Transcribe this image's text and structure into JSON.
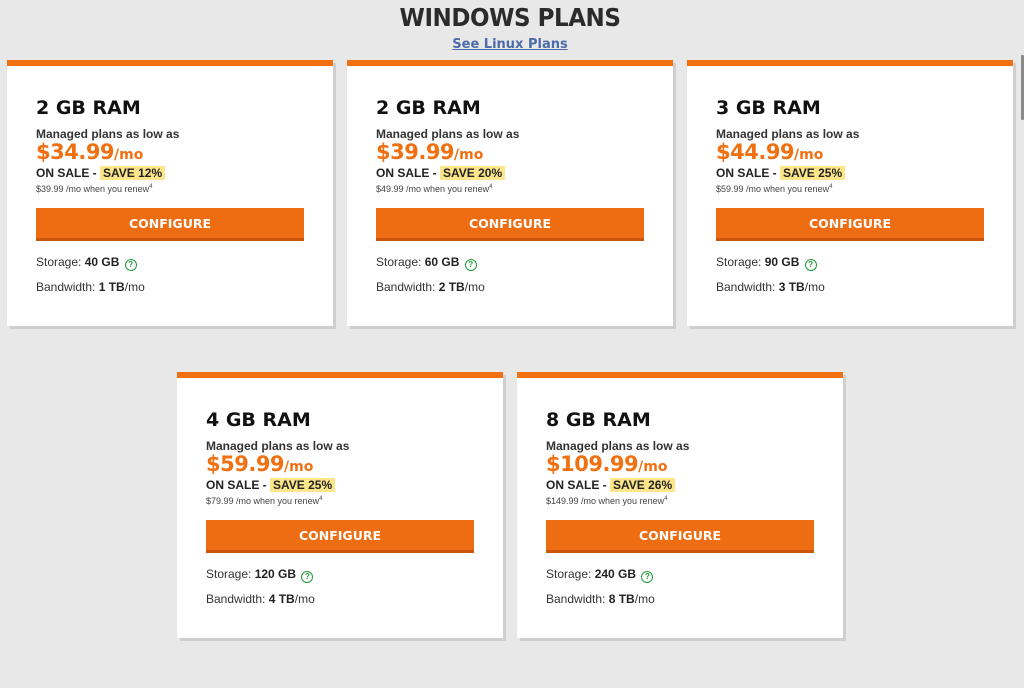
{
  "header": {
    "title": "WINDOWS PLANS",
    "link_label": "See Linux Plans"
  },
  "colors": {
    "accent": "#f07012",
    "save_highlight": "#fde68a",
    "help_icon": "#1f9d3a",
    "link": "#4b6ca8"
  },
  "plans": [
    {
      "ram": "2 GB RAM",
      "managed": "Managed plans as low as",
      "price": "$34.99",
      "per": "/mo",
      "on_sale": "ON SALE - ",
      "save": "SAVE 12%",
      "renew": "$39.99 /mo when you renew",
      "footnote": "4",
      "button": "CONFIGURE",
      "storage_label": "Storage: ",
      "storage": "40 GB",
      "bandwidth_label": "Bandwidth: ",
      "bandwidth": "1 TB",
      "bandwidth_unit": "/mo"
    },
    {
      "ram": "2 GB RAM",
      "managed": "Managed plans as low as",
      "price": "$39.99",
      "per": "/mo",
      "on_sale": "ON SALE - ",
      "save": "SAVE 20%",
      "renew": "$49.99 /mo when you renew",
      "footnote": "4",
      "button": "CONFIGURE",
      "storage_label": "Storage: ",
      "storage": "60 GB",
      "bandwidth_label": "Bandwidth: ",
      "bandwidth": "2 TB",
      "bandwidth_unit": "/mo"
    },
    {
      "ram": "3 GB RAM",
      "managed": "Managed plans as low as",
      "price": "$44.99",
      "per": "/mo",
      "on_sale": "ON SALE - ",
      "save": "SAVE 25%",
      "renew": "$59.99 /mo when you renew",
      "footnote": "4",
      "button": "CONFIGURE",
      "storage_label": "Storage: ",
      "storage": "90 GB",
      "bandwidth_label": "Bandwidth: ",
      "bandwidth": "3 TB",
      "bandwidth_unit": "/mo"
    },
    {
      "ram": "4 GB RAM",
      "managed": "Managed plans as low as",
      "price": "$59.99",
      "per": "/mo",
      "on_sale": "ON SALE - ",
      "save": "SAVE 25%",
      "renew": "$79.99 /mo when you renew",
      "footnote": "4",
      "button": "CONFIGURE",
      "storage_label": "Storage: ",
      "storage": "120 GB",
      "bandwidth_label": "Bandwidth: ",
      "bandwidth": "4 TB",
      "bandwidth_unit": "/mo"
    },
    {
      "ram": "8 GB RAM",
      "managed": "Managed plans as low as",
      "price": "$109.99",
      "per": "/mo",
      "on_sale": "ON SALE - ",
      "save": "SAVE 26%",
      "renew": "$149.99 /mo when you renew",
      "footnote": "4",
      "button": "CONFIGURE",
      "storage_label": "Storage: ",
      "storage": "240 GB",
      "bandwidth_label": "Bandwidth: ",
      "bandwidth": "8 TB",
      "bandwidth_unit": "/mo"
    }
  ],
  "icons": {
    "help": "?"
  }
}
